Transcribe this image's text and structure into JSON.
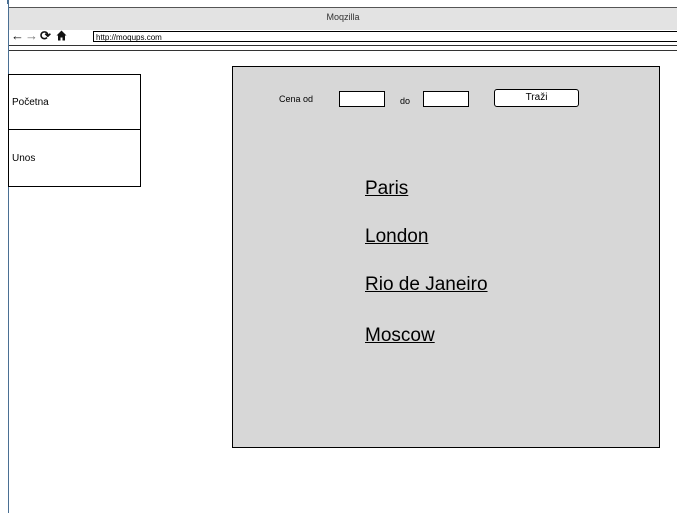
{
  "browser": {
    "title": "Moqzilla",
    "url": "http://moqups.com",
    "icons": [
      "back-arrow-icon",
      "forward-arrow-icon",
      "reload-icon",
      "home-icon"
    ]
  },
  "sidebar": {
    "items": [
      {
        "label": "Početna"
      },
      {
        "label": "Unos"
      }
    ]
  },
  "search": {
    "from_label": "Cena od",
    "to_label": "do",
    "button_label": "Traži",
    "min_value": "",
    "max_value": ""
  },
  "cities": [
    {
      "name": "Paris"
    },
    {
      "name": "London"
    },
    {
      "name": "Rio de Janeiro"
    },
    {
      "name": "Moscow"
    }
  ],
  "colors": {
    "panel_background": "#d7d7d7",
    "titlebar_background": "#e3e3e3",
    "accent_line": "#4a6f93"
  }
}
